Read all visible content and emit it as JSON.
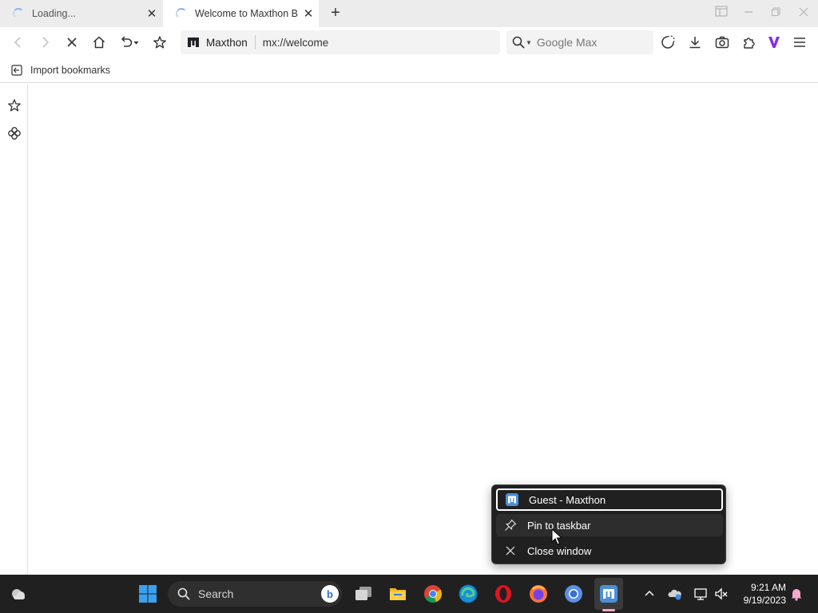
{
  "tabs": [
    {
      "title": "Loading...",
      "close": "✕"
    },
    {
      "title": "Welcome to Maxthon Br",
      "close": "✕"
    }
  ],
  "new_tab_label": "+",
  "address_bar": {
    "site_name": "Maxthon",
    "url": "mx://welcome"
  },
  "search_box": {
    "placeholder": "Google Max"
  },
  "bookmarks_bar": {
    "import_label": "Import bookmarks"
  },
  "context_menu": {
    "items": [
      {
        "label": "Guest - Maxthon",
        "icon": "maxthon-app-icon"
      },
      {
        "label": "Pin to taskbar",
        "icon": "pin-icon"
      },
      {
        "label": "Close window",
        "icon": "close-icon"
      }
    ]
  },
  "taskbar": {
    "search_label": "Search",
    "time": "9:21 AM",
    "date": "9/19/2023"
  },
  "colors": {
    "tabstrip_bg": "#ececec",
    "taskbar_bg": "#202020",
    "menu_bg": "#202020",
    "maxthon_accent": "#8a2be2"
  }
}
